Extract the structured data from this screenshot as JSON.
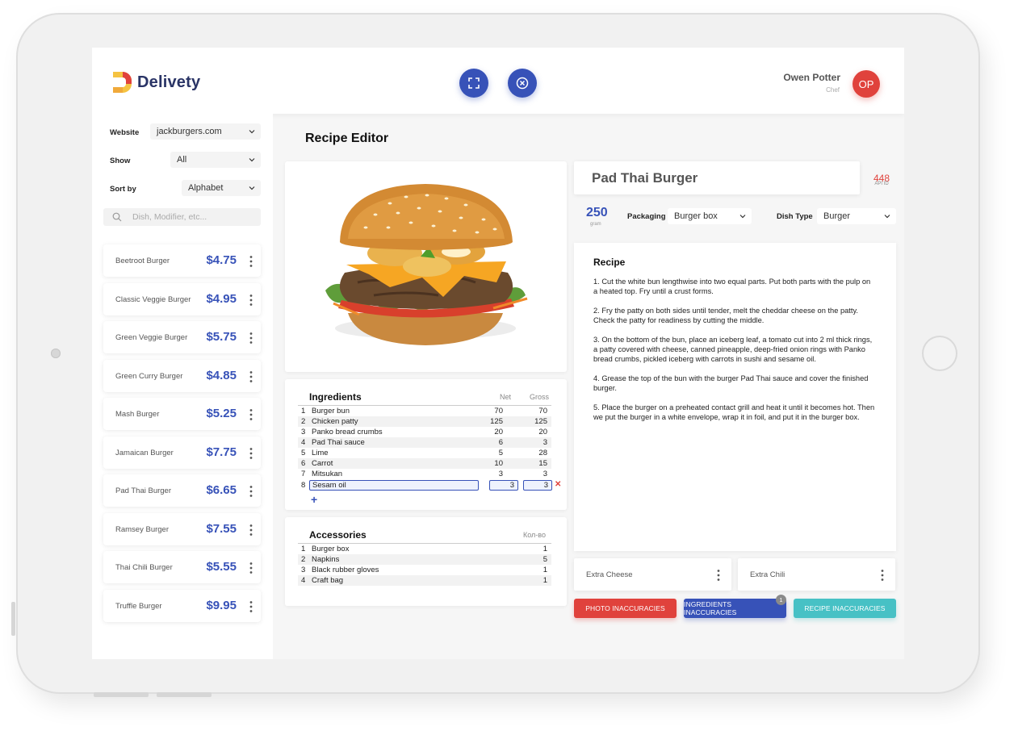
{
  "app": {
    "name": "Delivety"
  },
  "header": {
    "user": {
      "name": "Owen Potter",
      "role": "Chef",
      "initials": "OP"
    },
    "buttons": [
      {
        "icon": "fullscreen-icon"
      },
      {
        "icon": "close-circle-icon"
      }
    ]
  },
  "filters": {
    "website": {
      "label": "Website",
      "value": "jackburgers.com"
    },
    "show": {
      "label": "Show",
      "value": "All"
    },
    "sort": {
      "label": "Sort by",
      "value": "Alphabet"
    },
    "search_placeholder": "Dish, Modifier, etc..."
  },
  "menu": [
    {
      "name": "Beetroot Burger",
      "price": "$4.75"
    },
    {
      "name": "Classic Veggie Burger",
      "price": "$4.95"
    },
    {
      "name": "Green Veggie Burger",
      "price": "$5.75"
    },
    {
      "name": "Green Curry Burger",
      "price": "$4.85"
    },
    {
      "name": "Mash Burger",
      "price": "$5.25"
    },
    {
      "name": "Jamaican Burger",
      "price": "$7.75"
    },
    {
      "name": "Pad Thai Burger",
      "price": "$6.65"
    },
    {
      "name": "Ramsey Burger",
      "price": "$7.55"
    },
    {
      "name": "Thai Chili Burger",
      "price": "$5.55"
    },
    {
      "name": "Truffle Burger",
      "price": "$9.95"
    }
  ],
  "editor": {
    "title": "Recipe Editor",
    "dish_name": "Pad Thai Burger",
    "api_id": "448",
    "api_id_label": "API ID",
    "weight": "250",
    "weight_unit": "gram",
    "packaging": {
      "label": "Packaging",
      "value": "Burger box"
    },
    "dish_type": {
      "label": "Dish Type",
      "value": "Burger"
    }
  },
  "ingredients": {
    "title": "Ingredients",
    "columns": [
      "Net",
      "Gross"
    ],
    "rows": [
      {
        "n": "1",
        "name": "Burger bun",
        "net": "70",
        "gross": "70"
      },
      {
        "n": "2",
        "name": "Chicken patty",
        "net": "125",
        "gross": "125"
      },
      {
        "n": "3",
        "name": "Panko bread crumbs",
        "net": "20",
        "gross": "20"
      },
      {
        "n": "4",
        "name": "Pad Thai sauce",
        "net": "6",
        "gross": "3"
      },
      {
        "n": "5",
        "name": "Lime",
        "net": "5",
        "gross": "28"
      },
      {
        "n": "6",
        "name": "Carrot",
        "net": "10",
        "gross": "15"
      },
      {
        "n": "7",
        "name": "Mitsukan",
        "net": "3",
        "gross": "3"
      },
      {
        "n": "8",
        "name": "Sesam oil",
        "net": "3",
        "gross": "3"
      }
    ],
    "add_symbol": "+",
    "remove_symbol": "✕"
  },
  "accessories": {
    "title": "Accessories",
    "column": "Кол-во",
    "rows": [
      {
        "n": "1",
        "name": "Burger box",
        "qty": "1"
      },
      {
        "n": "2",
        "name": "Napkins",
        "qty": "5"
      },
      {
        "n": "3",
        "name": "Black rubber gloves",
        "qty": "1"
      },
      {
        "n": "4",
        "name": "Craft bag",
        "qty": "1"
      }
    ]
  },
  "recipe": {
    "title": "Recipe",
    "steps": [
      "1. Cut the white bun lengthwise into two equal parts. Put both parts with the pulp on a heated top. Fry until a crust forms.",
      "2. Fry the patty on both sides until tender, melt the cheddar cheese on the patty. Check the patty for readiness by cutting the middle.",
      "3. On the bottom of the bun, place an iceberg leaf, a tomato cut into 2 ml thick rings, a patty covered with cheese, canned pineapple, deep-fried onion rings with Panko bread crumbs, pickled iceberg with carrots in sushi and sesame oil.",
      "4. Grease the top of the bun with the burger Pad Thai sauce and cover the finished burger.",
      " 5. Place the burger on a preheated contact grill and heat it until it becomes hot. Then we put the burger in a white envelope, wrap it in foil, and put it in the burger box."
    ]
  },
  "modifiers": [
    {
      "name": "Extra Cheese"
    },
    {
      "name": "Extra Chili"
    }
  ],
  "actions": [
    {
      "label": "PHOTO INACCURACIES",
      "color": "#e0423c"
    },
    {
      "label": "INGREDIENTS  INACCURACIES",
      "color": "#3752b8",
      "badge": "1"
    },
    {
      "label": "RECIPE  INACCURACIES",
      "color": "#47c1c5"
    }
  ]
}
